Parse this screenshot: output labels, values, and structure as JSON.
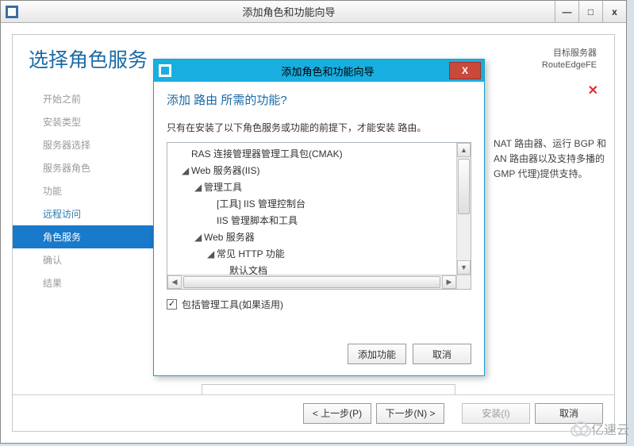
{
  "main_window": {
    "title": "添加角色和功能向导",
    "controls": {
      "minimize": "—",
      "maximize": "□",
      "close": "x"
    }
  },
  "header": {
    "page_title": "选择角色服务",
    "target_label": "目标服务器",
    "target_name": "RouteEdgeFE"
  },
  "sidebar": {
    "items": [
      {
        "label": "开始之前",
        "cls": ""
      },
      {
        "label": "安装类型",
        "cls": ""
      },
      {
        "label": "服务器选择",
        "cls": ""
      },
      {
        "label": "服务器角色",
        "cls": ""
      },
      {
        "label": "功能",
        "cls": ""
      },
      {
        "label": "远程访问",
        "cls": "link"
      },
      {
        "label": "角色服务",
        "cls": "active"
      },
      {
        "label": "确认",
        "cls": ""
      },
      {
        "label": "结果",
        "cls": ""
      }
    ]
  },
  "background_desc": {
    "l1": "NAT 路由器、运行 BGP 和",
    "l2": "AN 路由器以及支持多播的",
    "l3": "GMP 代理)提供支持。"
  },
  "footer": {
    "prev": "< 上一步(P)",
    "next": "下一步(N) >",
    "install": "安装(I)",
    "cancel": "取消"
  },
  "dialog": {
    "title": "添加角色和功能向导",
    "close": "X",
    "question": "添加 路由 所需的功能?",
    "note": "只有在安装了以下角色服务或功能的前提下，才能安装 路由。",
    "tree": [
      {
        "text": "RAS 连接管理器管理工具包(CMAK)",
        "indent": "i1",
        "expander": ""
      },
      {
        "text": "Web 服务器(IIS)",
        "indent": "i1",
        "expander": "◢"
      },
      {
        "text": "管理工具",
        "indent": "i2",
        "expander": "◢"
      },
      {
        "text": "[工具] IIS 管理控制台",
        "indent": "i3",
        "expander": ""
      },
      {
        "text": "IIS 管理脚本和工具",
        "indent": "i3",
        "expander": ""
      },
      {
        "text": "Web 服务器",
        "indent": "i2",
        "expander": "◢"
      },
      {
        "text": "常见 HTTP 功能",
        "indent": "i3",
        "expander": "◢"
      },
      {
        "text": "默认文档",
        "indent": "i4",
        "expander": ""
      }
    ],
    "include_label": "包括管理工具(如果适用)",
    "add_btn": "添加功能",
    "cancel_btn": "取消"
  },
  "watermark": "亿速云"
}
